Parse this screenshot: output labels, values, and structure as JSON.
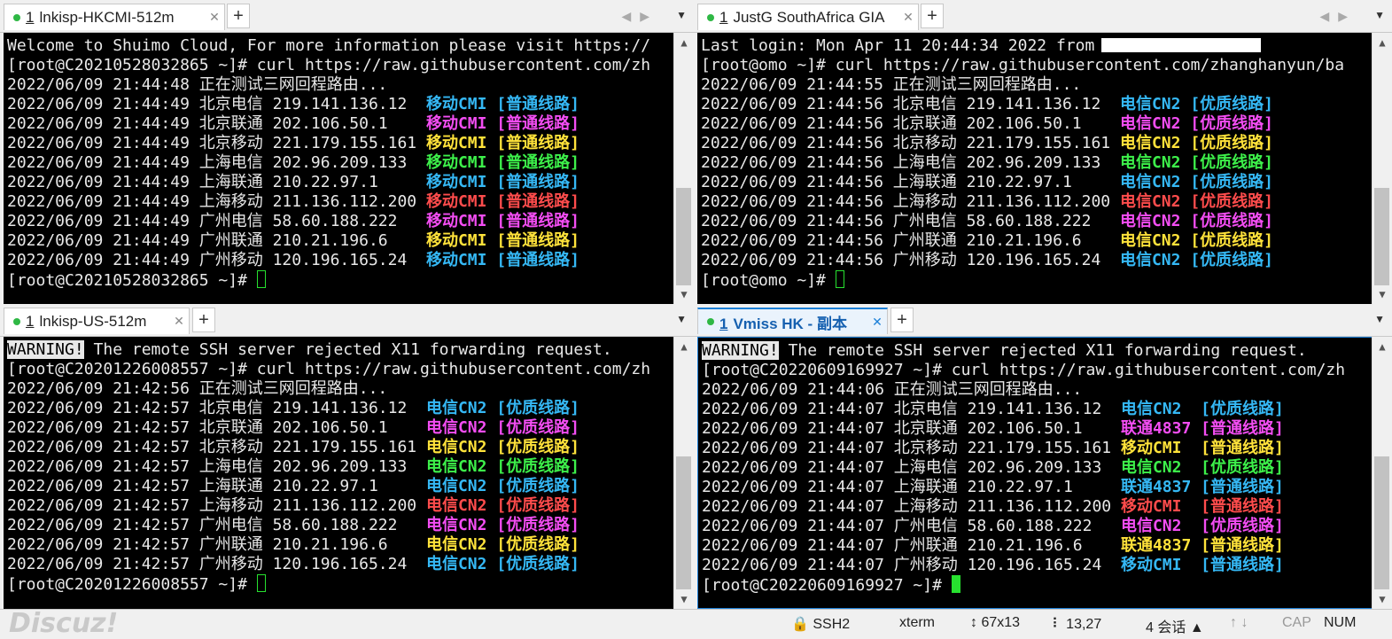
{
  "panes": [
    {
      "tab": {
        "num": "1",
        "title": "lnkisp-HKCMI-512m",
        "active": false
      },
      "lines": [
        {
          "text": "Welcome to Shuimo Cloud, For more information please visit https://"
        },
        {
          "text": "[root@C20210528032865 ~]# curl https://raw.githubusercontent.com/zh"
        },
        {
          "text": "2022/06/09 21:44:48 正在测试三网回程路由..."
        },
        {
          "text": "2022/06/09 21:44:49 北京电信 219.141.136.12  ",
          "tag": "移动CMI",
          "route": "[普通线路]",
          "color": "cyan"
        },
        {
          "text": "2022/06/09 21:44:49 北京联通 202.106.50.1    ",
          "tag": "移动CMI",
          "route": "[普通线路]",
          "color": "mag"
        },
        {
          "text": "2022/06/09 21:44:49 北京移动 221.179.155.161 ",
          "tag": "移动CMI",
          "route": "[普通线路]",
          "color": "yel"
        },
        {
          "text": "2022/06/09 21:44:49 上海电信 202.96.209.133  ",
          "tag": "移动CMI",
          "route": "[普通线路]",
          "color": "grn"
        },
        {
          "text": "2022/06/09 21:44:49 上海联通 210.22.97.1     ",
          "tag": "移动CMI",
          "route": "[普通线路]",
          "color": "cyan"
        },
        {
          "text": "2022/06/09 21:44:49 上海移动 211.136.112.200 ",
          "tag": "移动CMI",
          "route": "[普通线路]",
          "color": "red"
        },
        {
          "text": "2022/06/09 21:44:49 广州电信 58.60.188.222   ",
          "tag": "移动CMI",
          "route": "[普通线路]",
          "color": "mag"
        },
        {
          "text": "2022/06/09 21:44:49 广州联通 210.21.196.6    ",
          "tag": "移动CMI",
          "route": "[普通线路]",
          "color": "yel"
        },
        {
          "text": "2022/06/09 21:44:49 广州移动 120.196.165.24  ",
          "tag": "移动CMI",
          "route": "[普通线路]",
          "color": "cyan"
        },
        {
          "text": "[root@C20210528032865 ~]# ",
          "cursor": "outline"
        }
      ]
    },
    {
      "tab": {
        "num": "1",
        "title": "JustG SouthAfrica GIA",
        "active": false
      },
      "lines": [
        {
          "text": "Last login: Mon Apr 11 20:44:34 2022 from",
          "redacted": true
        },
        {
          "text": "[root@omo ~]# curl https://raw.githubusercontent.com/zhanghanyun/ba"
        },
        {
          "text": "2022/06/09 21:44:55 正在测试三网回程路由..."
        },
        {
          "text": "2022/06/09 21:44:56 北京电信 219.141.136.12  ",
          "tag": "电信CN2",
          "route": "[优质线路]",
          "color": "cyan"
        },
        {
          "text": "2022/06/09 21:44:56 北京联通 202.106.50.1    ",
          "tag": "电信CN2",
          "route": "[优质线路]",
          "color": "mag"
        },
        {
          "text": "2022/06/09 21:44:56 北京移动 221.179.155.161 ",
          "tag": "电信CN2",
          "route": "[优质线路]",
          "color": "yel"
        },
        {
          "text": "2022/06/09 21:44:56 上海电信 202.96.209.133  ",
          "tag": "电信CN2",
          "route": "[优质线路]",
          "color": "grn"
        },
        {
          "text": "2022/06/09 21:44:56 上海联通 210.22.97.1     ",
          "tag": "电信CN2",
          "route": "[优质线路]",
          "color": "cyan"
        },
        {
          "text": "2022/06/09 21:44:56 上海移动 211.136.112.200 ",
          "tag": "电信CN2",
          "route": "[优质线路]",
          "color": "red"
        },
        {
          "text": "2022/06/09 21:44:56 广州电信 58.60.188.222   ",
          "tag": "电信CN2",
          "route": "[优质线路]",
          "color": "mag"
        },
        {
          "text": "2022/06/09 21:44:56 广州联通 210.21.196.6    ",
          "tag": "电信CN2",
          "route": "[优质线路]",
          "color": "yel"
        },
        {
          "text": "2022/06/09 21:44:56 广州移动 120.196.165.24  ",
          "tag": "电信CN2",
          "route": "[优质线路]",
          "color": "cyan"
        },
        {
          "text": "[root@omo ~]# ",
          "cursor": "outline"
        }
      ]
    },
    {
      "tab": {
        "num": "1",
        "title": "lnkisp-US-512m",
        "active": false
      },
      "lines": [
        {
          "warn": "WARNING!",
          "text": " The remote SSH server rejected X11 forwarding request."
        },
        {
          "text": "[root@C20201226008557 ~]# curl https://raw.githubusercontent.com/zh"
        },
        {
          "text": "2022/06/09 21:42:56 正在测试三网回程路由..."
        },
        {
          "text": "2022/06/09 21:42:57 北京电信 219.141.136.12  ",
          "tag": "电信CN2",
          "route": "[优质线路]",
          "color": "cyan"
        },
        {
          "text": "2022/06/09 21:42:57 北京联通 202.106.50.1    ",
          "tag": "电信CN2",
          "route": "[优质线路]",
          "color": "mag"
        },
        {
          "text": "2022/06/09 21:42:57 北京移动 221.179.155.161 ",
          "tag": "电信CN2",
          "route": "[优质线路]",
          "color": "yel"
        },
        {
          "text": "2022/06/09 21:42:57 上海电信 202.96.209.133  ",
          "tag": "电信CN2",
          "route": "[优质线路]",
          "color": "grn"
        },
        {
          "text": "2022/06/09 21:42:57 上海联通 210.22.97.1     ",
          "tag": "电信CN2",
          "route": "[优质线路]",
          "color": "cyan"
        },
        {
          "text": "2022/06/09 21:42:57 上海移动 211.136.112.200 ",
          "tag": "电信CN2",
          "route": "[优质线路]",
          "color": "red"
        },
        {
          "text": "2022/06/09 21:42:57 广州电信 58.60.188.222   ",
          "tag": "电信CN2",
          "route": "[优质线路]",
          "color": "mag"
        },
        {
          "text": "2022/06/09 21:42:57 广州联通 210.21.196.6    ",
          "tag": "电信CN2",
          "route": "[优质线路]",
          "color": "yel"
        },
        {
          "text": "2022/06/09 21:42:57 广州移动 120.196.165.24  ",
          "tag": "电信CN2",
          "route": "[优质线路]",
          "color": "cyan"
        },
        {
          "text": "[root@C20201226008557 ~]# ",
          "cursor": "outline"
        }
      ]
    },
    {
      "tab": {
        "num": "1",
        "title": "Vmiss HK - 副本",
        "active": true
      },
      "lines": [
        {
          "warn": "WARNING!",
          "text": " The remote SSH server rejected X11 forwarding request."
        },
        {
          "text": "[root@C20220609169927 ~]# curl https://raw.githubusercontent.com/zh"
        },
        {
          "text": "2022/06/09 21:44:06 正在测试三网回程路由..."
        },
        {
          "text": "2022/06/09 21:44:07 北京电信 219.141.136.12  ",
          "tag": "电信CN2 ",
          "route": "[优质线路]",
          "color": "cyan"
        },
        {
          "text": "2022/06/09 21:44:07 北京联通 202.106.50.1    ",
          "tag": "联通4837",
          "route": "[普通线路]",
          "color": "mag"
        },
        {
          "text": "2022/06/09 21:44:07 北京移动 221.179.155.161 ",
          "tag": "移动CMI ",
          "route": "[普通线路]",
          "color": "yel"
        },
        {
          "text": "2022/06/09 21:44:07 上海电信 202.96.209.133  ",
          "tag": "电信CN2 ",
          "route": "[优质线路]",
          "color": "grn"
        },
        {
          "text": "2022/06/09 21:44:07 上海联通 210.22.97.1     ",
          "tag": "联通4837",
          "route": "[普通线路]",
          "color": "cyan"
        },
        {
          "text": "2022/06/09 21:44:07 上海移动 211.136.112.200 ",
          "tag": "移动CMI ",
          "route": "[普通线路]",
          "color": "red"
        },
        {
          "text": "2022/06/09 21:44:07 广州电信 58.60.188.222   ",
          "tag": "电信CN2 ",
          "route": "[优质线路]",
          "color": "mag"
        },
        {
          "text": "2022/06/09 21:44:07 广州联通 210.21.196.6    ",
          "tag": "联通4837",
          "route": "[普通线路]",
          "color": "yel"
        },
        {
          "text": "2022/06/09 21:44:07 广州移动 120.196.165.24  ",
          "tag": "移动CMI ",
          "route": "[普通线路]",
          "color": "cyan"
        },
        {
          "text": "[root@C20220609169927 ~]# ",
          "cursor": "solid"
        }
      ]
    }
  ],
  "colors": {
    "cyan": "#35b8f5",
    "mag": "#f34df3",
    "yel": "#ffe23a",
    "grn": "#3df04a",
    "red": "#ff4c4c",
    "tab_active": "#1c80d8"
  },
  "statusbar": {
    "logo": "Discuz!",
    "protocol": "SSH2",
    "terminal_type": "xterm",
    "size": "67x13",
    "cursor_pos": "13,27",
    "sessions": "4 会话",
    "cap": "CAP",
    "num": "NUM"
  },
  "tab_labels": {
    "add": "+",
    "close": "✕"
  }
}
